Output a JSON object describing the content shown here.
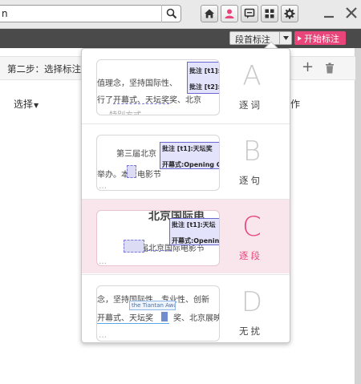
{
  "search": {
    "value": "n"
  },
  "toolbar": {
    "icons": [
      "search-icon",
      "home-icon",
      "user-icon",
      "comment-icon",
      "grid-icon",
      "gear-icon"
    ],
    "mode_label": "段首标注",
    "start_label": "开始标注",
    "accent": "#e8457a"
  },
  "panel": {
    "step_title": "第二步：选择标注",
    "select_label": "选择",
    "work_label": "作"
  },
  "options": [
    {
      "letter": "A",
      "label": "逐词",
      "selected": false,
      "lines": [
        "值理念，坚持国际性、",
        "行了开幕式、天坛奖奖、北京",
        "… 特别方式 …"
      ],
      "notes": [
        "批注 [t1]:",
        "批注 [t2]:"
      ]
    },
    {
      "letter": "B",
      "label": "逐句",
      "selected": false,
      "lines": [
        "第三届北京",
        "举办。本届电影节",
        "…"
      ],
      "notes": [
        "批注 [t1]:天坛奖",
        "开幕式:Opening Ce"
      ]
    },
    {
      "letter": "C",
      "label": "逐段",
      "selected": true,
      "lines": [
        "北京国际电",
        "第三届北京国际电影节",
        "…"
      ],
      "notes": [
        "批注 [t1]:天坛",
        "开幕式:Opening"
      ]
    },
    {
      "letter": "D",
      "label": "无扰",
      "selected": false,
      "lines": [
        "念，坚持国际性、专业性、创新",
        "开幕式、天坛奖",
        "奖、北京展映",
        "…"
      ],
      "notes": [
        "the Tiantan Award"
      ]
    }
  ]
}
